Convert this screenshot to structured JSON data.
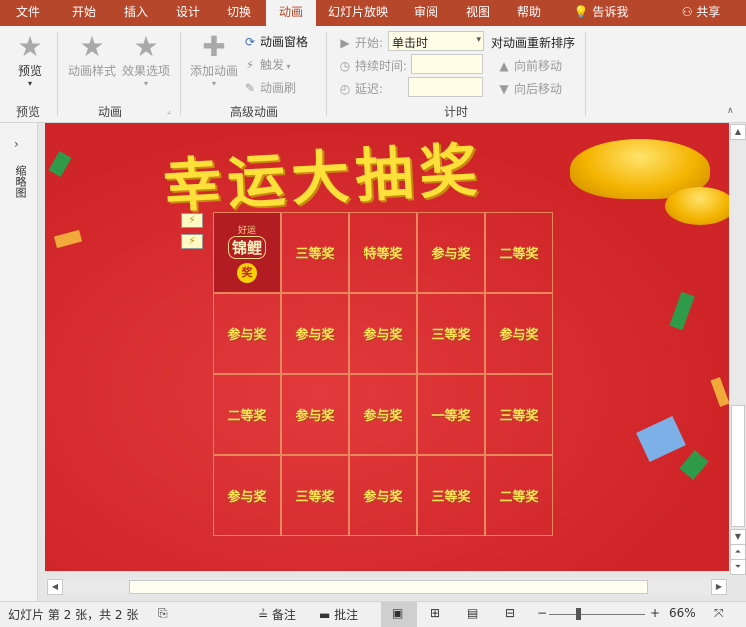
{
  "tabs": [
    "文件",
    "开始",
    "插入",
    "设计",
    "切换",
    "动画",
    "幻灯片放映",
    "审阅",
    "视图",
    "帮助"
  ],
  "tell_me": "告诉我",
  "share": "共享",
  "ribbon": {
    "preview_btn": "预览",
    "preview_group": "预览",
    "anim_style_btn": "动画样式",
    "effect_options_btn": "效果选项",
    "anim_group": "动画",
    "add_anim_btn": "添加动画",
    "anim_pane_btn": "动画窗格",
    "trigger_btn": "触发",
    "anim_painter_btn": "动画刷",
    "adv_anim_group": "高级动画",
    "start_label": "开始:",
    "start_value": "单击时",
    "duration_label": "持续时间:",
    "delay_label": "延迟:",
    "timing_group": "计时",
    "reorder_label": "对动画重新排序",
    "move_earlier": "向前移动",
    "move_later": "向后移动"
  },
  "thumbpane": {
    "label": "缩略图"
  },
  "slide": {
    "title": "幸运大抽奖",
    "logo_top": "好运",
    "logo_main": "锦鲤",
    "logo_badge": "奖",
    "cells": [
      [
        "三等奖",
        "特等奖",
        "参与奖",
        "二等奖"
      ],
      [
        "参与奖",
        "参与奖",
        "参与奖",
        "三等奖",
        "参与奖"
      ],
      [
        "二等奖",
        "参与奖",
        "参与奖",
        "一等奖",
        "三等奖"
      ],
      [
        "参与奖",
        "三等奖",
        "参与奖",
        "三等奖",
        "二等奖"
      ]
    ]
  },
  "status": {
    "slide_info": "幻灯片 第 2 张，共 2 张",
    "notes": "备注",
    "comments": "批注",
    "zoom": "66%"
  },
  "colors": {
    "accent": "#b7472a",
    "slide_bg": "#d9262b",
    "gold": "#ffdf3a"
  }
}
